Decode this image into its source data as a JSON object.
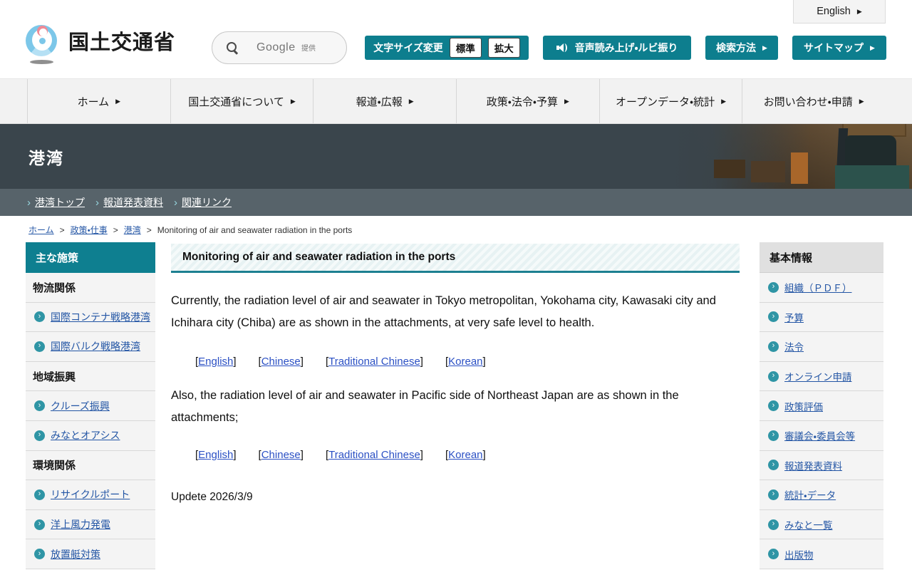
{
  "icons": {
    "arrow_right": "▶",
    "chevron": "›"
  },
  "colors": {
    "teal": "#0d7e8e",
    "teal_dark": "#1d8091",
    "link_blue": "#2456a5",
    "attachment_link_blue": "#2b50c4",
    "banner_bg": "#3a454c",
    "subnav_bg": "#57636a",
    "nav_bg": "#f2f2f2",
    "sidebar_row_bg": "#f4f4f4"
  },
  "header": {
    "logo_text": "国土交通省",
    "search": {
      "provider": "Google",
      "provided_by": "提供"
    },
    "english_button": "English",
    "tools": {
      "font_size_label": "文字サイズ変更",
      "font_standard": "標準",
      "font_large": "拡大",
      "voice_label": "音声読み上げ・ルビ振り",
      "search_method_label": "検索方法",
      "sitemap_label": "サイトマップ"
    }
  },
  "nav": {
    "items": [
      "ホーム",
      "国土交通省について",
      "報道・広報",
      "政策・法令・予算",
      "オープンデータ・統計",
      "お問い合わせ・申請"
    ]
  },
  "banner": {
    "title": "港湾"
  },
  "subnav": {
    "items": [
      "港湾トップ",
      "報道発表資料",
      "関連リンク"
    ]
  },
  "breadcrumb": {
    "separator": ">",
    "links": [
      "ホーム",
      "政策・仕事",
      "港湾"
    ],
    "current": "Monitoring of air and seawater radiation in the ports"
  },
  "left_sidebar": {
    "title": "主な施策",
    "rows": [
      {
        "type": "section",
        "label": "物流関係"
      },
      {
        "type": "link",
        "label": "国際コンテナ戦略港湾"
      },
      {
        "type": "link",
        "label": "国際バルク戦略港湾"
      },
      {
        "type": "section",
        "label": "地域振興"
      },
      {
        "type": "link",
        "label": "クルーズ振興"
      },
      {
        "type": "link",
        "label": "みなとオアシス"
      },
      {
        "type": "section",
        "label": "環境関係"
      },
      {
        "type": "link",
        "label": "リサイクルポート"
      },
      {
        "type": "link",
        "label": "洋上風力発電"
      },
      {
        "type": "link",
        "label": "放置艇対策"
      }
    ]
  },
  "main": {
    "title": "Monitoring of air and seawater radiation in the ports",
    "bracket_open": "[",
    "bracket_close": "]",
    "paragraph1": "Currently, the radiation level of air and seawater in Tokyo metropolitan, Yokohama city, Kawasaki city and Ichihara city (Chiba) are as shown in the attachments, at very safe level to health.",
    "links1": [
      "English",
      "Chinese",
      "Traditional Chinese",
      "Korean"
    ],
    "paragraph2": "Also, the radiation level of air and seawater in Pacific side of Northeast Japan are as shown in the attachments;",
    "links2": [
      "English",
      "Chinese",
      "Traditional Chinese",
      "Korean"
    ],
    "update": "Updete 2026/3/9"
  },
  "right_sidebar": {
    "title": "基本情報",
    "items": [
      "組織（ＰＤＦ）",
      "予算",
      "法令",
      "オンライン申請",
      "政策評価",
      "審議会・委員会等",
      "報道発表資料",
      "統計・データ",
      "みなと一覧",
      "出版物"
    ]
  }
}
